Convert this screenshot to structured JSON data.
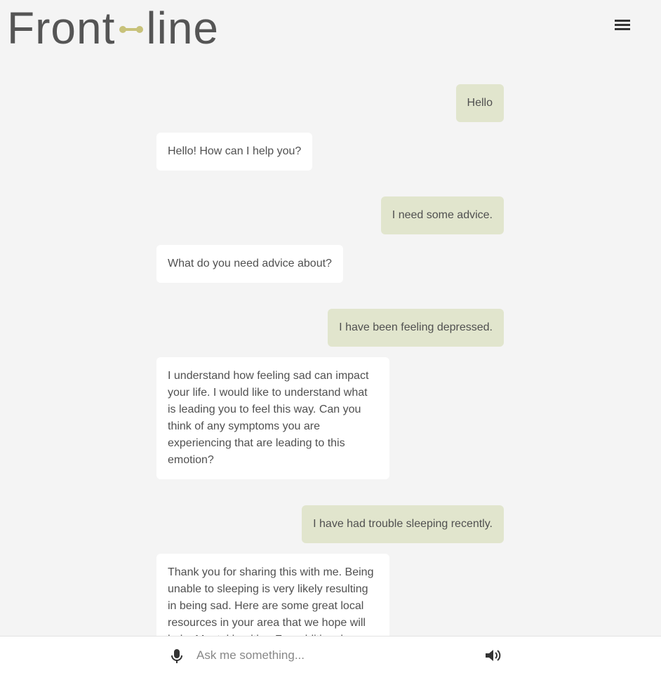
{
  "header": {
    "logo_left": "Front",
    "logo_right": "line"
  },
  "messages": [
    {
      "role": "user",
      "text": "Hello"
    },
    {
      "role": "bot",
      "text": "Hello! How can I help you?"
    },
    {
      "role": "user",
      "text": "I need some advice."
    },
    {
      "role": "bot",
      "text": "What do you need advice about?"
    },
    {
      "role": "user",
      "text": "I have been feeling depressed."
    },
    {
      "role": "bot",
      "text": "I understand how feeling sad can impact your life. I would like to understand what is leading you to feel this way. Can you think of any symptoms you are experiencing that are leading to this emotion?"
    },
    {
      "role": "user",
      "text": "I have had trouble sleeping recently."
    },
    {
      "role": "bot",
      "text": "Thank you for sharing this with me. Being unable to sleeping is very likely resulting in being sad. Here are some great local resources in your area that we hope will help. Mental health... For additional..."
    }
  ],
  "input": {
    "placeholder": "Ask me something...",
    "value": ""
  },
  "icons": {
    "menu": "hamburger-menu-icon",
    "mic": "microphone-icon",
    "speaker": "speaker-icon"
  },
  "colors": {
    "background": "#f4f4f4",
    "user_bubble": "#e1e5cd",
    "bot_bubble": "#ffffff",
    "logo_accent": "#c8c27a"
  }
}
